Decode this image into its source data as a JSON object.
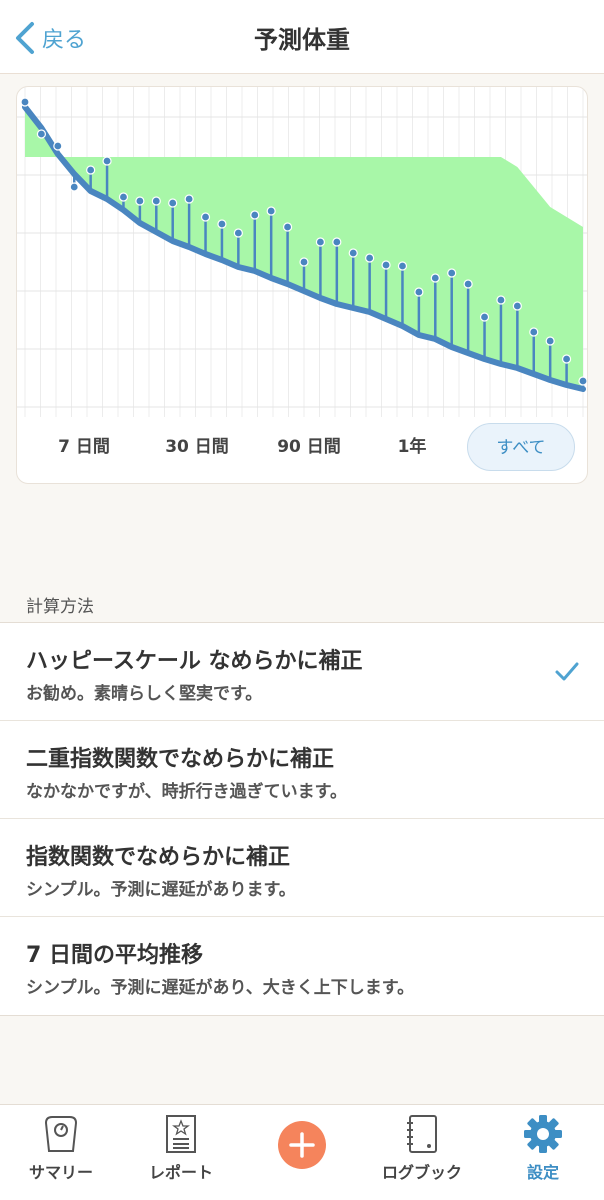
{
  "header": {
    "back_label": "戻る",
    "title": "予測体重"
  },
  "chart_data": {
    "type": "line",
    "title": "",
    "xlabel": "",
    "ylabel": "",
    "grid": true,
    "x": [
      1,
      2,
      3,
      4,
      5,
      6,
      7,
      8,
      9,
      10,
      11,
      12,
      13,
      14,
      15,
      16,
      17,
      18,
      19,
      20,
      21,
      22,
      23,
      24,
      25,
      26,
      27,
      28,
      29,
      30,
      31,
      32,
      33,
      34,
      35
    ],
    "series": [
      {
        "values": [
          100,
          97.9,
          95.3,
          93.3,
          91.6,
          90.8,
          89.7,
          88.4,
          87.5,
          86.6,
          86.0,
          85.3,
          84.7,
          84.0,
          83.6,
          82.9,
          82.3,
          81.6,
          80.9,
          80.3,
          79.9,
          79.5,
          78.8,
          78.1,
          77.2,
          76.8,
          76.0,
          75.4,
          74.8,
          74.3,
          73.9,
          73.3,
          72.7,
          72.2,
          71.8
        ]
      },
      {
        "values": [
          100.5,
          97.3,
          96.1,
          92.0,
          93.7,
          94.6,
          91.0,
          90.6,
          90.6,
          90.4,
          90.8,
          89.0,
          88.3,
          87.4,
          89.2,
          89.6,
          88.0,
          84.5,
          86.5,
          86.5,
          85.4,
          84.9,
          84.2,
          84.1,
          81.5,
          82.9,
          83.4,
          82.3,
          79.0,
          80.7,
          80.1,
          77.5,
          76.6,
          74.8,
          72.6
        ]
      }
    ],
    "band_top": [
      95,
      95,
      95,
      95,
      95,
      95,
      95,
      95,
      95,
      95,
      95,
      95,
      95,
      95,
      95,
      95,
      95,
      95,
      95,
      95,
      95,
      95,
      95,
      95,
      95,
      95,
      95,
      95,
      95,
      95,
      94,
      92,
      90,
      89,
      88
    ],
    "ylim": [
      70,
      101
    ],
    "accent_color": "#4a86c0",
    "band_color": "#a8f7a8"
  },
  "ranges": [
    {
      "label": "7 日間"
    },
    {
      "label": "30 日間"
    },
    {
      "label": "90 日間"
    },
    {
      "label": "1年"
    },
    {
      "label": "すべて",
      "active": true
    }
  ],
  "section_label": "計算方法",
  "methods": [
    {
      "title": "ハッピースケール なめらかに補正",
      "subtitle": "お勧め。素晴らしく堅実です。",
      "selected": true
    },
    {
      "title": "二重指数関数でなめらかに補正",
      "subtitle": "なかなかですが、時折行き過ぎています。",
      "selected": false
    },
    {
      "title": "指数関数でなめらかに補正",
      "subtitle": "シンプル。予測に遅延があります。",
      "selected": false
    },
    {
      "title": "7 日間の平均推移",
      "subtitle": "シンプル。予測に遅延があり、大きく上下します。",
      "selected": false
    }
  ],
  "tabbar": {
    "items": [
      {
        "label": "サマリー",
        "icon": "scale-icon"
      },
      {
        "label": "レポート",
        "icon": "report-icon"
      },
      {
        "label": "",
        "icon": "plus-icon"
      },
      {
        "label": "ログブック",
        "icon": "logbook-icon"
      },
      {
        "label": "設定",
        "icon": "gear-icon",
        "active": true
      }
    ]
  },
  "colors": {
    "accent": "#4fa3d1",
    "active_tab": "#3d8ec4",
    "add_button": "#f5845c"
  }
}
